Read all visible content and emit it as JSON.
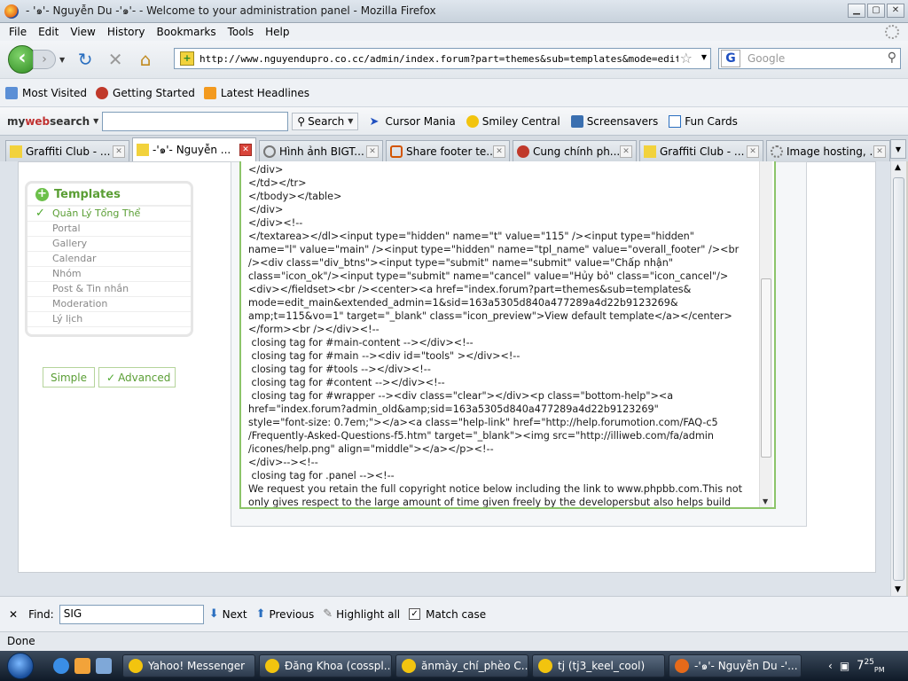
{
  "window": {
    "title": "- '๑'- Nguyễn Du -'๑'- - Welcome to your administration panel - Mozilla Firefox"
  },
  "menu": [
    "File",
    "Edit",
    "View",
    "History",
    "Bookmarks",
    "Tools",
    "Help"
  ],
  "nav": {
    "url": "http://www.nguyendupro.co.cc/admin/index.forum?part=themes&sub=templates&mode=edit_main&",
    "search_placeholder": "Google"
  },
  "bookmarks": [
    "Most Visited",
    "Getting Started",
    "Latest Headlines"
  ],
  "mywebsearch": {
    "logo_a": "my",
    "logo_b": "web",
    "logo_c": "search",
    "search_button": "Search",
    "items": [
      "Cursor Mania",
      "Smiley Central",
      "Screensavers",
      "Fun Cards"
    ]
  },
  "tabs": [
    {
      "label": "Graffiti Club - ...",
      "active": false
    },
    {
      "label": "-'๑'- Nguyễn ...",
      "active": true
    },
    {
      "label": "Hình ảnh BIGT...",
      "active": false
    },
    {
      "label": "Share footer te...",
      "active": false
    },
    {
      "label": "Cung chính ph...",
      "active": false
    },
    {
      "label": "Graffiti Club - ...",
      "active": false
    },
    {
      "label": "Image hosting, ...",
      "active": false
    }
  ],
  "sidebar": {
    "title": "Templates",
    "items": [
      "Quản Lý Tổng Thể",
      "Portal",
      "Gallery",
      "Calendar",
      "Nhóm",
      "Post & Tin nhắn",
      "Moderation",
      "Lý lịch"
    ],
    "simple_button": "Simple",
    "advanced_button": "Advanced"
  },
  "editor": {
    "lines": [
      "</div>",
      "</td></tr>",
      "</tbody></table>",
      "</div>",
      "</div><!--",
      "</textarea></dl><input type=\"hidden\" name=\"t\" value=\"115\" /><input type=\"hidden\"",
      "name=\"l\" value=\"main\" /><input type=\"hidden\" name=\"tpl_name\" value=\"overall_footer\" /><br",
      "/><div class=\"div_btns\"><input type=\"submit\" name=\"submit\" value=\"Chấp nhận\"",
      "class=\"icon_ok\"/><input type=\"submit\" name=\"cancel\" value=\"Hủy bỏ\" class=\"icon_cancel\"/>",
      "<div></fieldset><br /><center><a href=\"index.forum?part=themes&sub=templates&",
      "mode=edit_main&extended_admin=1&sid=163a5305d840a477289a4d22b9123269&",
      "amp;t=115&vo=1\" target=\"_blank\" class=\"icon_preview\">View default template</a></center>",
      "</form><br /></div><!--",
      " closing tag for #main-content --></div><!--",
      " closing tag for #main --><div id=\"tools\" ></div><!--",
      " closing tag for #tools --></div><!--",
      " closing tag for #content --></div><!--",
      " closing tag for #wrapper --><div class=\"clear\"></div><p class=\"bottom-help\"><a",
      "href=\"index.forum?admin_old&amp;sid=163a5305d840a477289a4d22b9123269\"",
      "style=\"font-size: 0.7em;\"></a><a class=\"help-link\" href=\"http://help.forumotion.com/FAQ-c5",
      "/Frequently-Asked-Questions-f5.htm\" target=\"_blank\"><img src=\"http://illiweb.com/fa/admin",
      "/icones/help.png\" align=\"middle\"></a></p><!--",
      "</div>--><!--",
      " closing tag for .panel --><!--",
      "We request you retain the full copyright notice below including the link to www.phpbb.com.This not",
      "only gives respect to the large amount of time given freely by the developersbut also helps build"
    ]
  },
  "findbar": {
    "label": "Find:",
    "value": "SIG",
    "next": "Next",
    "previous": "Previous",
    "highlight": "Highlight all",
    "match_case": "Match case",
    "match_case_checked": true
  },
  "status": "Done",
  "taskbar": {
    "tasks": [
      "Yahoo! Messenger",
      "Đăng Khoa (cosspl...",
      "ănmày_chí_phèo C...",
      "tj (tj3_keel_cool)",
      "-'๑'- Nguyễn Du -'..."
    ],
    "clock_hour": "7",
    "clock_min": "25",
    "clock_ampm": "PM"
  }
}
